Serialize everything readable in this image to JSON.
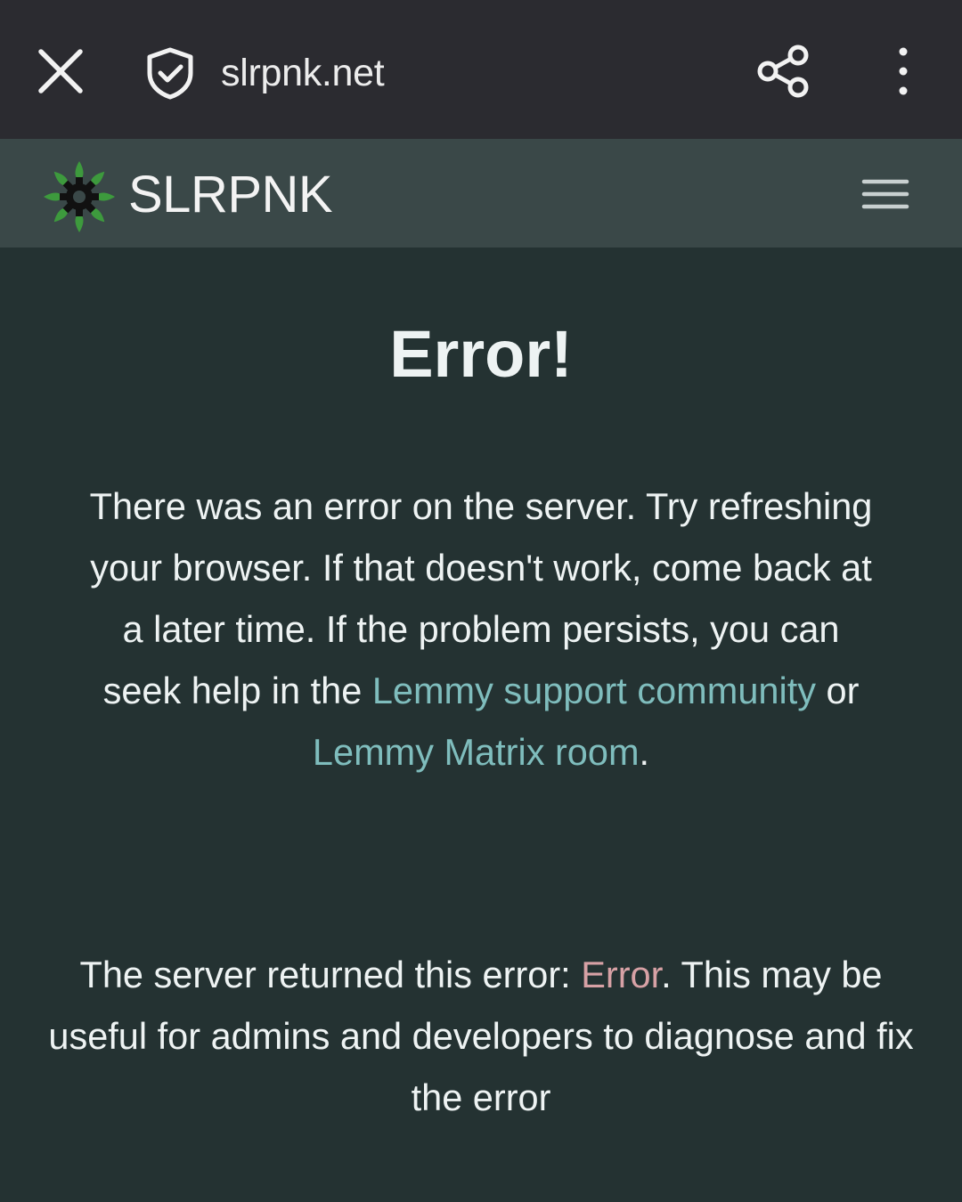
{
  "browser": {
    "url": "slrpnk.net",
    "close_icon": "close-icon",
    "security_icon": "shield-check-icon",
    "share_icon": "share-icon",
    "menu_icon": "more-vertical-icon"
  },
  "site_nav": {
    "site_name": "SLRPNK",
    "logo_icon": "solarpunk-gear-logo",
    "menu_icon": "hamburger-menu-icon"
  },
  "error": {
    "title": "Error!",
    "message_part1": "There was an error on the server. Try refreshing your browser. If that doesn't work, come back at a later time. If the problem persists, you can seek help in the ",
    "support_link": "Lemmy support community",
    "message_or": " or ",
    "matrix_link": "Lemmy Matrix room",
    "message_end": ".",
    "server_prefix": "The server returned this error: ",
    "server_code": "Error",
    "server_suffix": ". This may be useful for admins and developers to diagnose and fix the error"
  },
  "colors": {
    "browser_bar": "#2b2b30",
    "nav_bar": "#3a4848",
    "page_bg": "#243232",
    "link": "#7fbdbd",
    "error_code": "#d7a1a5",
    "text": "#eef3f3"
  }
}
